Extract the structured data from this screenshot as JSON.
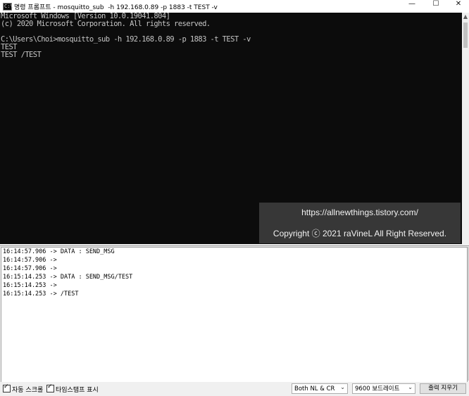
{
  "window": {
    "title": "명령 프롬프트 - mosquitto_sub  -h 192.168.0.89 -p 1883 -t TEST -v",
    "icon_text": "C:\\",
    "controls": {
      "minimize": "—",
      "maximize": "☐",
      "close": "✕"
    }
  },
  "console": {
    "lines": [
      "Microsoft Windows [Version 10.0.19041.804]",
      "(c) 2020 Microsoft Corporation. All rights reserved.",
      "",
      "C:\\Users\\Choi>mosquitto_sub -h 192.168.0.89 -p 1883 -t TEST -v",
      "TEST",
      "TEST /TEST"
    ],
    "scroll_up": "▲"
  },
  "watermark": {
    "line1": "https://allnewthings.tistory.com/",
    "line2": "Copyright ⓒ 2021 raVineL All Right Reserved."
  },
  "serial": {
    "lines": [
      "16:14:57.906 -> DATA : SEND_MSG",
      "16:14:57.906 ->",
      "16:14:57.906 ->",
      "16:15:14.253 -> DATA : SEND_MSG/TEST",
      "16:15:14.253 ->",
      "16:15:14.253 -> /TEST"
    ],
    "autoscroll_label": "자동 스크롤",
    "timestamp_label": "타임스탬프 표시",
    "line_ending": "Both NL & CR",
    "baud": "9600 보드레이트",
    "clear_button": "출력 지우기",
    "dropdown_arrow": "⌄"
  }
}
